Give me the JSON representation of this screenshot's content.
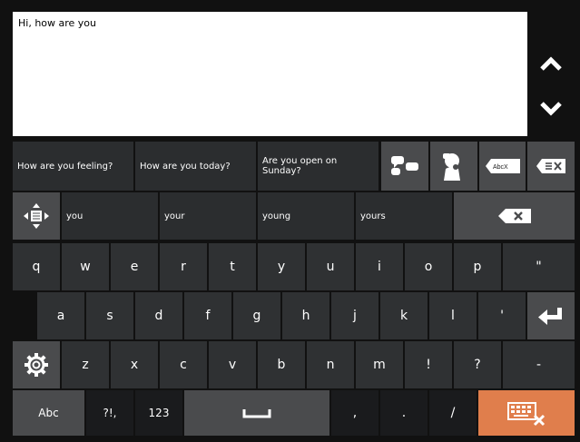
{
  "textarea": {
    "value": "Hi,  how are you"
  },
  "nav": {
    "up_icon": "chevron-up-icon",
    "down_icon": "chevron-down-icon"
  },
  "suggestions": [
    "How are you feeling?",
    "How are you today?",
    "Are you open on Sunday?"
  ],
  "tools": {
    "chat_icon": "speech-bubbles-icon",
    "speak_icon": "speaking-head-icon",
    "delete_word_label": "AbcX",
    "clear_icon": "clear-text-icon"
  },
  "predictions": [
    "you",
    "your",
    "young",
    "yours"
  ],
  "rows": {
    "row1": [
      "q",
      "w",
      "e",
      "r",
      "t",
      "y",
      "u",
      "i",
      "o",
      "p",
      "\""
    ],
    "row2": [
      "a",
      "s",
      "d",
      "f",
      "g",
      "h",
      "j",
      "k",
      "l",
      "'"
    ],
    "row3": [
      "z",
      "x",
      "c",
      "v",
      "b",
      "n",
      "m",
      "!",
      "?",
      "-"
    ],
    "row4": {
      "abc": "Abc",
      "symbols": "?!,",
      "numbers": "123",
      "comma": ",",
      "period": ".",
      "slash": "/"
    }
  },
  "colors": {
    "accent": "#e07e4c",
    "key": "#2f3133",
    "key_dark": "#1a1b1d",
    "key_gray": "#4a4b4d"
  }
}
